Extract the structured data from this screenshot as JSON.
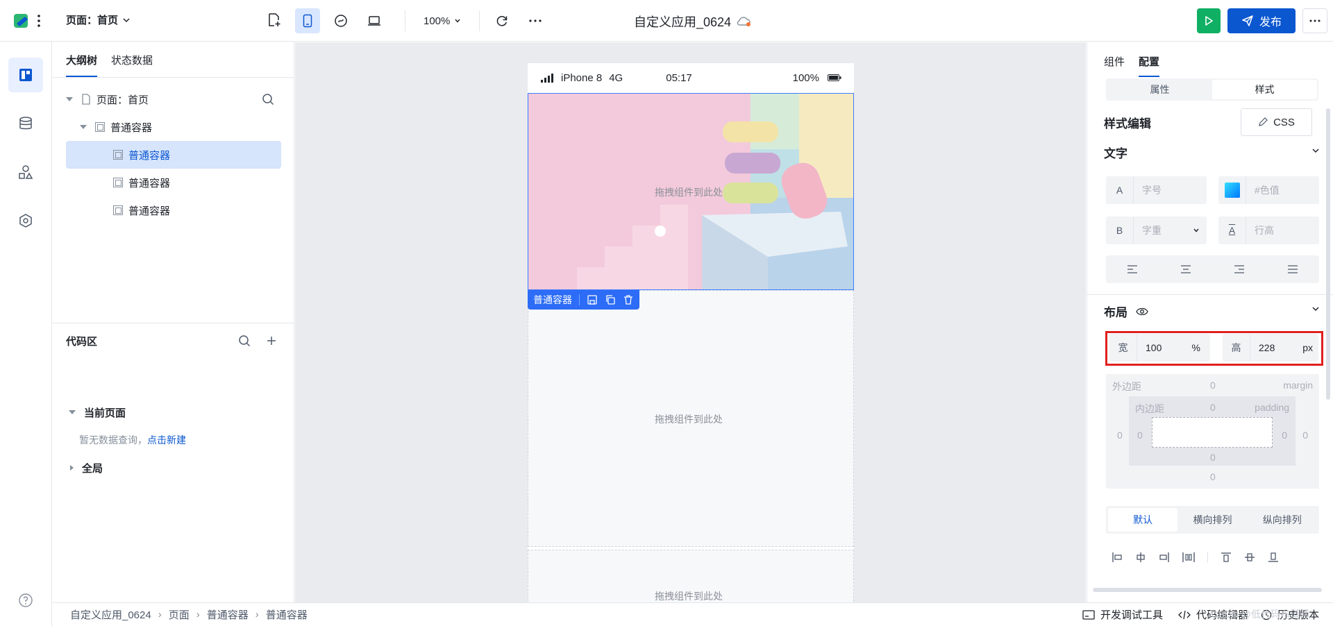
{
  "header": {
    "page_select": "页面：首页",
    "zoom": "100%",
    "app_title": "自定义应用_0624",
    "publish_label": "发布"
  },
  "outline": {
    "tabs": [
      "大纲树",
      "状态数据"
    ],
    "tree": [
      {
        "label": "页面：首页"
      },
      {
        "label": "普通容器"
      },
      {
        "label": "普通容器",
        "selected": true
      },
      {
        "label": "普通容器"
      },
      {
        "label": "普通容器"
      }
    ]
  },
  "code_area": {
    "title": "代码区",
    "current_page": "当前页面",
    "empty_text": "暂无数据查询，",
    "create_link": "点击新建",
    "global": "全局"
  },
  "phone": {
    "device": "iPhone 8",
    "network": "4G",
    "time": "05:17",
    "battery": "100%",
    "drop_hint": "拖拽组件到此处",
    "selected_label": "普通容器"
  },
  "right_panel": {
    "tabs": [
      "组件",
      "配置"
    ],
    "segments": [
      "属性",
      "样式"
    ],
    "style_edit_title": "样式编辑",
    "css_button": "CSS",
    "text_section": "文字",
    "font_size_placeholder": "字号",
    "color_placeholder": "#色值",
    "font_weight_placeholder": "字重",
    "line_height_placeholder": "行高",
    "layout_section": "布局",
    "width_label": "宽",
    "width_value": "100",
    "width_unit": "%",
    "height_label": "高",
    "height_value": "228",
    "height_unit": "px",
    "margin_label": "外边距",
    "margin_en": "margin",
    "padding_label": "内边距",
    "padding_en": "padding",
    "zero": "0",
    "direction_tabs": [
      "默认",
      "横向排列",
      "纵向排列"
    ]
  },
  "footer": {
    "breadcrumb": [
      "自定义应用_0624",
      "页面",
      "普通容器",
      "普通容器"
    ],
    "dev_tools": "开发调试工具",
    "code_view": "代码编辑器",
    "history": "历史版本",
    "watermark": "CSDN @低代码布道师"
  },
  "colors": {
    "brand": "#0b57d0",
    "run_green": "#10b064",
    "highlight_red": "#e0201f"
  }
}
